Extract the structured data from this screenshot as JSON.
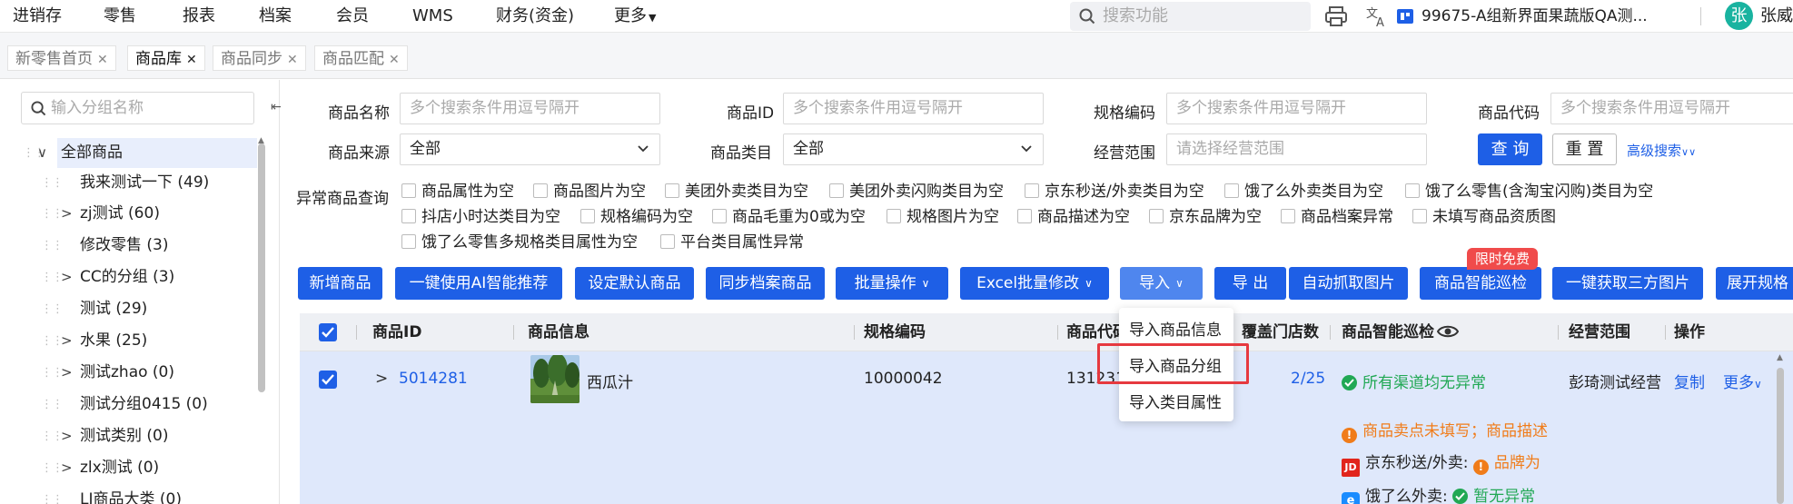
{
  "topnav": {
    "menus": [
      "进销存",
      "零售",
      "报表",
      "档案",
      "会员",
      "WMS",
      "财务(资金)",
      "更多"
    ],
    "search_placeholder": "搜索功能",
    "store_name": "99675-A组新界面果蔬版QA测...",
    "avatar_char": "张",
    "username": "张威"
  },
  "tabs": [
    {
      "label": "新零售首页",
      "active": false
    },
    {
      "label": "商品库",
      "active": true
    },
    {
      "label": "商品同步",
      "active": false
    },
    {
      "label": "商品匹配",
      "active": false
    }
  ],
  "sidebar": {
    "search_placeholder": "输入分组名称",
    "collapse_icon": "⇤",
    "tree": [
      {
        "label": "全部商品",
        "level": 0,
        "expandable": true,
        "expanded": true
      },
      {
        "label": "我来测试一下 (49)",
        "level": 1,
        "expandable": false
      },
      {
        "label": "zj测试 (60)",
        "level": 1,
        "expandable": true
      },
      {
        "label": "修改零售 (3)",
        "level": 1,
        "expandable": false
      },
      {
        "label": "CC的分组 (3)",
        "level": 1,
        "expandable": true
      },
      {
        "label": "测试 (29)",
        "level": 1,
        "expandable": false
      },
      {
        "label": "水果 (25)",
        "level": 1,
        "expandable": true
      },
      {
        "label": "测试zhao (0)",
        "level": 1,
        "expandable": true
      },
      {
        "label": "测试分组0415 (0)",
        "level": 1,
        "expandable": false
      },
      {
        "label": "测试类别 (0)",
        "level": 1,
        "expandable": true
      },
      {
        "label": "zlx测试 (0)",
        "level": 1,
        "expandable": true
      },
      {
        "label": "LJ商品大类 (0)",
        "level": 1,
        "expandable": false
      }
    ]
  },
  "filters": {
    "name_label": "商品名称",
    "name_placeholder": "多个搜索条件用逗号隔开",
    "id_label": "商品ID",
    "id_placeholder": "多个搜索条件用逗号隔开",
    "spec_label": "规格编码",
    "spec_placeholder": "多个搜索条件用逗号隔开",
    "code_label": "商品代码",
    "code_placeholder": "多个搜索条件用逗号隔开",
    "source_label": "商品来源",
    "source_value": "全部",
    "category_label": "商品类目",
    "category_value": "全部",
    "scope_label": "经营范围",
    "scope_placeholder": "请选择经营范围",
    "query_button": "查 询",
    "reset_button": "重 置",
    "advanced_link": "高级搜索",
    "abnormal_label": "异常商品查询",
    "abnormal_options": [
      "商品属性为空",
      "商品图片为空",
      "美团外卖类目为空",
      "美团外卖闪购类目为空",
      "京东秒送/外卖类目为空",
      "饿了么外卖类目为空",
      "饿了么零售(含淘宝闪购)类目为空",
      "抖店小时达类目为空",
      "规格编码为空",
      "商品毛重为0或为空",
      "规格图片为空",
      "商品描述为空",
      "京东品牌为空",
      "商品档案异常",
      "未填写商品资质图",
      "饿了么零售多规格类目属性为空",
      "平台类目属性异常"
    ]
  },
  "actions": {
    "buttons": [
      "新增商品",
      "一键使用AI智能推荐",
      "设定默认商品",
      "同步档案商品",
      "批量操作",
      "Excel批量修改",
      "导入",
      "导 出",
      "自动抓取图片",
      "商品智能巡检",
      "一键获取三方图片",
      "展开规格"
    ],
    "free_badge": "限时免费"
  },
  "import_menu": {
    "items": [
      "导入商品信息",
      "导入商品分组",
      "导入类目属性"
    ],
    "highlighted_index": 1
  },
  "table": {
    "headers": {
      "id": "商品ID",
      "info": "商品信息",
      "spec": "规格编码",
      "code": "商品代码",
      "stores": "覆盖门店数",
      "inspection": "商品智能巡检",
      "scope": "经营范围",
      "ops": "操作"
    },
    "rows": [
      {
        "checked": true,
        "id": "5014281",
        "name": "西瓜汁",
        "spec": "10000042",
        "code": "131231",
        "stores": "2/25",
        "inspection_ok": "所有渠道均无异常",
        "inspection_warn": "商品卖点未填写；商品描述",
        "jd_label": "京东秒送/外卖:",
        "jd_status": "品牌为",
        "ele_label": "饿了么外卖:",
        "ele_status": "暂无异常",
        "scope": "彭琦测试经营",
        "op_copy": "复制",
        "op_more": "更多"
      }
    ]
  },
  "colors": {
    "primary": "#1e5fe6",
    "selected_row": "#dfe8fb",
    "success": "#21a854",
    "warning": "#f07c1a",
    "badge_red": "#f04b4b",
    "highlight_box": "#e6393f"
  }
}
